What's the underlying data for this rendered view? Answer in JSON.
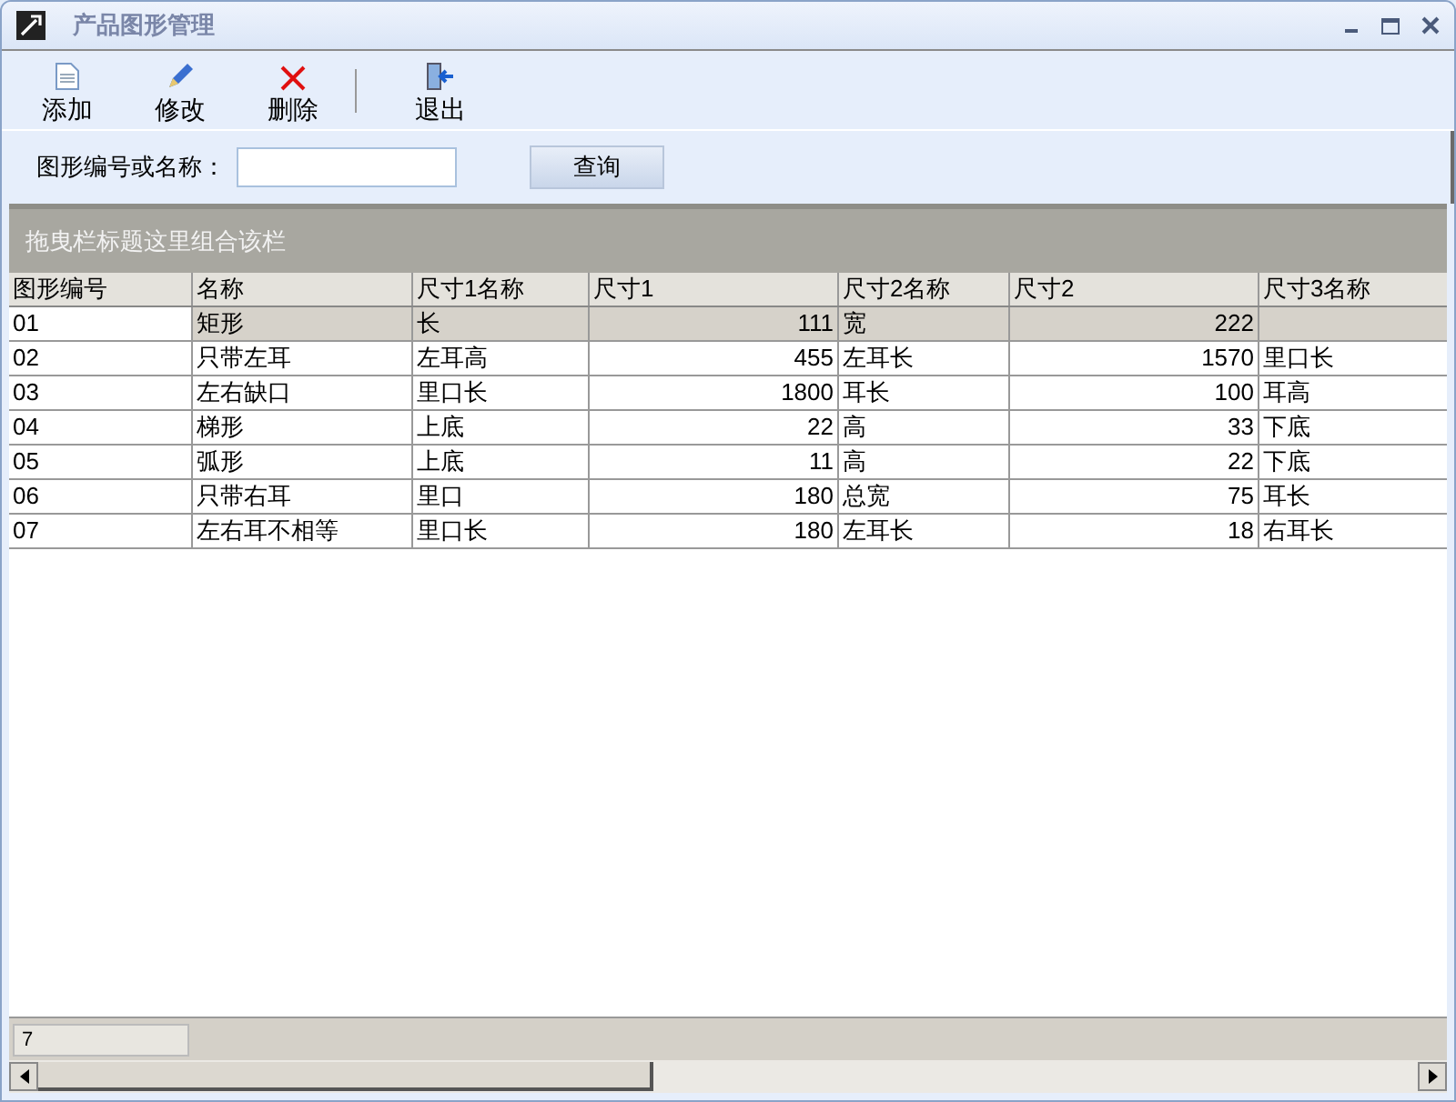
{
  "window": {
    "title": "产品图形管理"
  },
  "toolbar": [
    {
      "label": "添加",
      "kind": "add"
    },
    {
      "label": "修改",
      "kind": "edit"
    },
    {
      "label": "删除",
      "kind": "delete"
    },
    {
      "label": "退出",
      "kind": "exit"
    }
  ],
  "search": {
    "label": "图形编号或名称：",
    "button": "查询"
  },
  "group_panel": {
    "hint": "拖曳栏标题这里组合该栏"
  },
  "table": {
    "columns": [
      {
        "title": "图形编号",
        "kind": "text"
      },
      {
        "title": "名称",
        "kind": "text"
      },
      {
        "title": "尺寸1名称",
        "kind": "text"
      },
      {
        "title": "尺寸1",
        "kind": "number"
      },
      {
        "title": "尺寸2名称",
        "kind": "text"
      },
      {
        "title": "尺寸2",
        "kind": "number"
      },
      {
        "title": "尺寸3名称",
        "kind": "text"
      }
    ],
    "rows": [
      {
        "selected": true,
        "cells": [
          "01",
          "矩形",
          "长",
          "111",
          "宽",
          "222",
          ""
        ]
      },
      {
        "selected": false,
        "cells": [
          "02",
          "只带左耳",
          "左耳高",
          "455",
          "左耳长",
          "1570",
          "里口长"
        ]
      },
      {
        "selected": false,
        "cells": [
          "03",
          "左右缺口",
          "里口长",
          "1800",
          "耳长",
          "100",
          "耳高"
        ]
      },
      {
        "selected": false,
        "cells": [
          "04",
          "梯形",
          "上底",
          "22",
          "高",
          "33",
          "下底"
        ]
      },
      {
        "selected": false,
        "cells": [
          "05",
          "弧形",
          "上底",
          "11",
          "高",
          "22",
          "下底"
        ]
      },
      {
        "selected": false,
        "cells": [
          "06",
          "只带右耳",
          "里口",
          "180",
          "总宽",
          "75",
          "耳长"
        ]
      },
      {
        "selected": false,
        "cells": [
          "07",
          "左右耳不相等",
          "里口长",
          "180",
          "左耳长",
          "18",
          "右耳长"
        ]
      }
    ]
  },
  "footer": {
    "count": "7"
  }
}
